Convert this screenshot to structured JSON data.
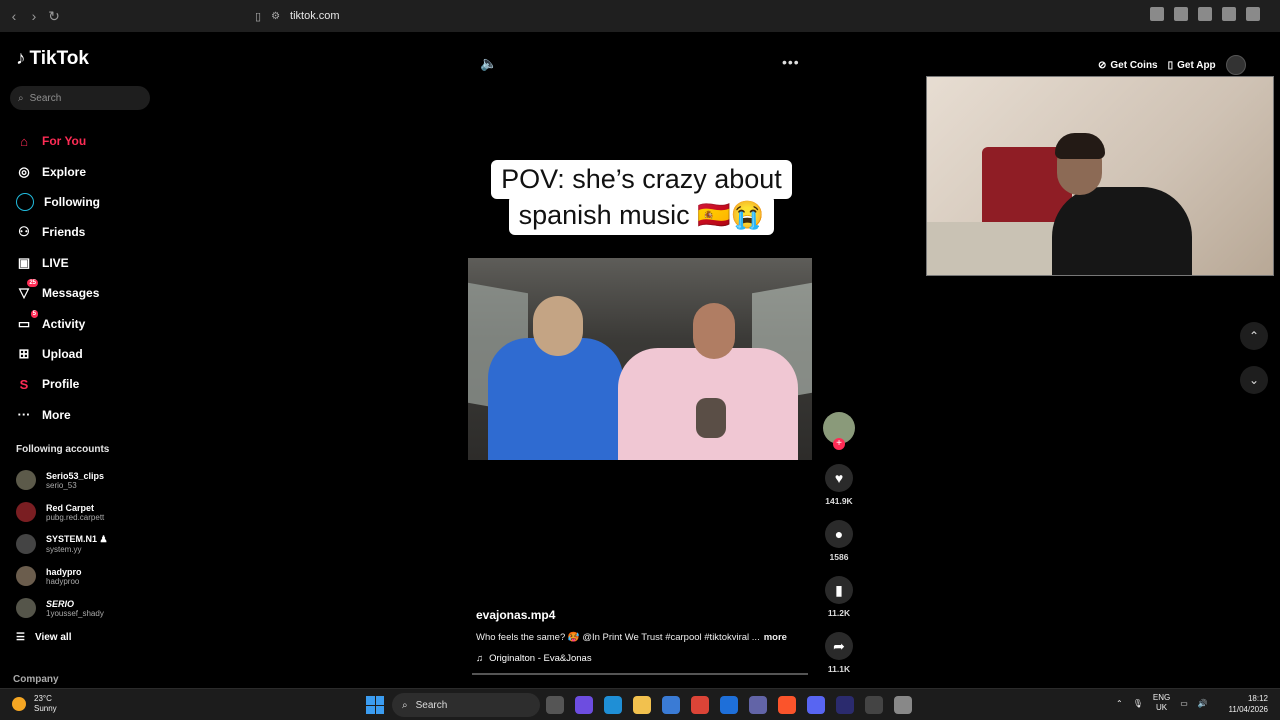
{
  "browser": {
    "url": "tiktok.com"
  },
  "sidebar": {
    "logo": "TikTok",
    "search_placeholder": "Search",
    "menu": [
      {
        "label": "For You",
        "icon": "home-icon",
        "active": true
      },
      {
        "label": "Explore",
        "icon": "compass-icon"
      },
      {
        "label": "Following",
        "icon": "following-icon"
      },
      {
        "label": "Friends",
        "icon": "friends-icon"
      },
      {
        "label": "LIVE",
        "icon": "live-icon"
      },
      {
        "label": "Messages",
        "icon": "messages-icon",
        "badge": "25"
      },
      {
        "label": "Activity",
        "icon": "activity-icon",
        "badge": "5"
      },
      {
        "label": "Upload",
        "icon": "upload-icon"
      },
      {
        "label": "Profile",
        "icon": "profile-icon"
      },
      {
        "label": "More",
        "icon": "more-icon"
      }
    ],
    "following_title": "Following accounts",
    "accounts": [
      {
        "name": "Serio53_clips",
        "handle": "serio_53"
      },
      {
        "name": "Red Carpet",
        "handle": "pubg.red.carpett"
      },
      {
        "name": "SYSTEM.N1 ♟",
        "handle": "system.yy"
      },
      {
        "name": "hadypro",
        "handle": "hadyproo"
      },
      {
        "name": "SERIO",
        "handle": "1youssef_shady"
      }
    ],
    "view_all": "View all",
    "company": "Company"
  },
  "video": {
    "caption_line1": "POV: she’s crazy about",
    "caption_line2": "spanish music 🇪🇸😭",
    "author": "evajonas.mp4",
    "description": "Who feels the same? 🥵 @In Print We Trust #carpool #tiktokviral ...",
    "more_label": "more",
    "music": "Originalton - Eva&Jonas",
    "likes": "141.9K",
    "comments": "1586",
    "saves": "11.2K",
    "shares": "11.1K"
  },
  "top_right": {
    "get_coins": "Get Coins",
    "get_app": "Get App"
  },
  "taskbar": {
    "temp": "23°C",
    "weather": "Sunny",
    "search_label": "Search",
    "lang_top": "ENG",
    "lang_bottom": "UK",
    "time": "18:12",
    "date": "11/04/2026"
  },
  "colors": {
    "accent": "#fe2c55",
    "background": "#000000"
  }
}
